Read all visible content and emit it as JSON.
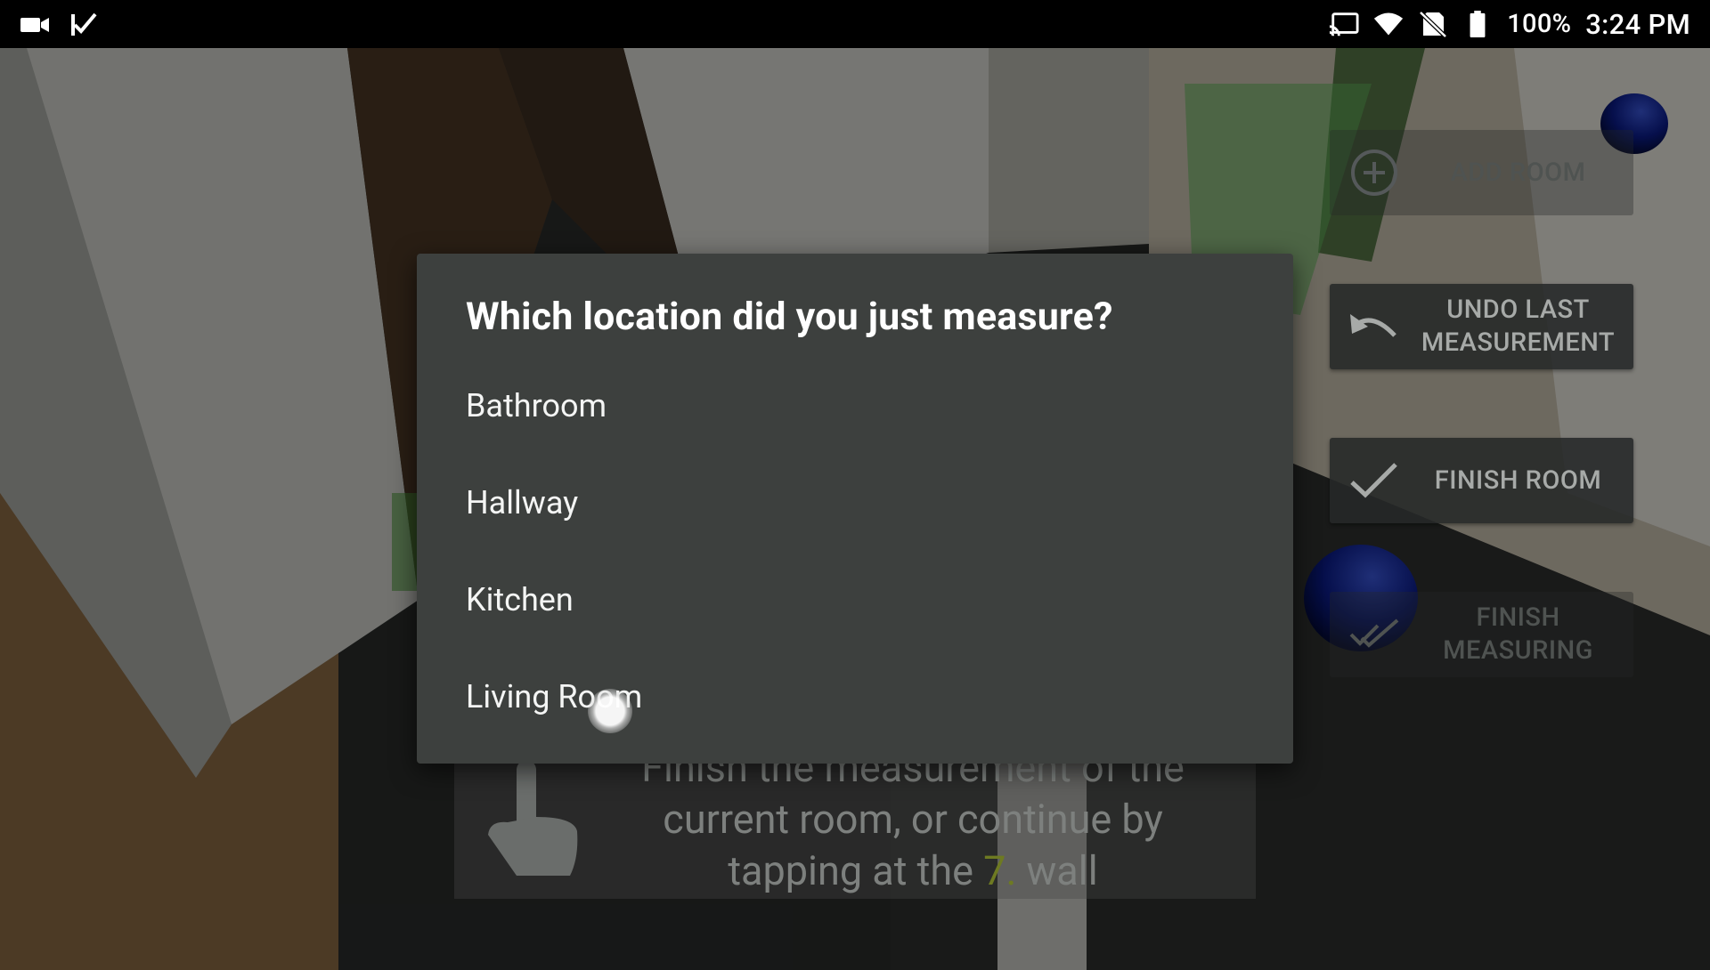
{
  "status_bar": {
    "battery": "100%",
    "time": "3:24 PM",
    "left_icons": [
      "video-camera-icon",
      "checkmark-flag-icon"
    ],
    "right_icons": [
      "cast-icon",
      "wifi-icon",
      "no-sim-icon",
      "battery-icon"
    ]
  },
  "side_buttons": {
    "add_room": {
      "label": "ADD ROOM",
      "icon": "add-circle-icon",
      "enabled": false
    },
    "undo": {
      "label": "UNDO LAST MEASUREMENT",
      "icon": "undo-icon",
      "enabled": true
    },
    "finish_room": {
      "label": "FINISH ROOM",
      "icon": "check-icon",
      "enabled": true
    },
    "finish_measuring": {
      "label": "FINISH MEASURING",
      "icon": "double-check-icon",
      "enabled": false
    }
  },
  "hint": {
    "line1": "Finish the measurement of the",
    "line2": "current room, or continue by",
    "line3_prefix": "tapping at the ",
    "wall_number": "7.",
    "line3_suffix": " wall"
  },
  "dialog": {
    "title": "Which location did you just measure?",
    "options": [
      "Bathroom",
      "Hallway",
      "Kitchen",
      "Living Room"
    ]
  },
  "colors": {
    "dialog_bg": "#3d403e",
    "accent_number": "#6e7a22",
    "status_bar_bg": "#000000",
    "marker_blue": "#0a1a7a"
  }
}
